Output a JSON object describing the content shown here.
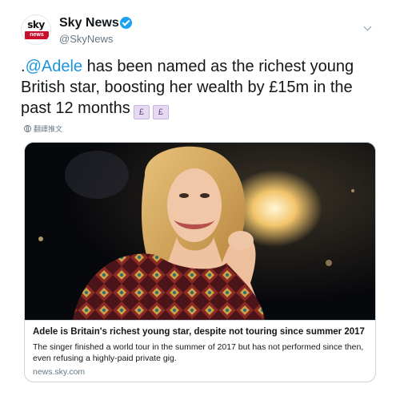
{
  "account": {
    "avatar_top": "sky",
    "avatar_bottom": "news",
    "display_name": "Sky News",
    "handle": "@SkyNews"
  },
  "tweet": {
    "prefix": ".",
    "mention": "@Adele",
    "text": " has been named as the richest young British star, boosting her wealth by £15m in the past 12 months",
    "emoji_glyph": "£"
  },
  "translate": {
    "label": "翻譯推文"
  },
  "card": {
    "title": "Adele is Britain's richest young star, despite not touring since summer 2017",
    "description": "The singer finished a world tour in the summer of 2017 but has not performed since then, even refusing a highly-paid private gig.",
    "domain": "news.sky.com"
  },
  "colors": {
    "mention": "#1b95e0",
    "verified": "#1da1f2",
    "sky_red": "#c8102e"
  },
  "icons": {
    "verified": "verified-badge-icon",
    "caret": "chevron-down-icon",
    "translate": "globe-icon",
    "money": "money-emoji-icon"
  }
}
